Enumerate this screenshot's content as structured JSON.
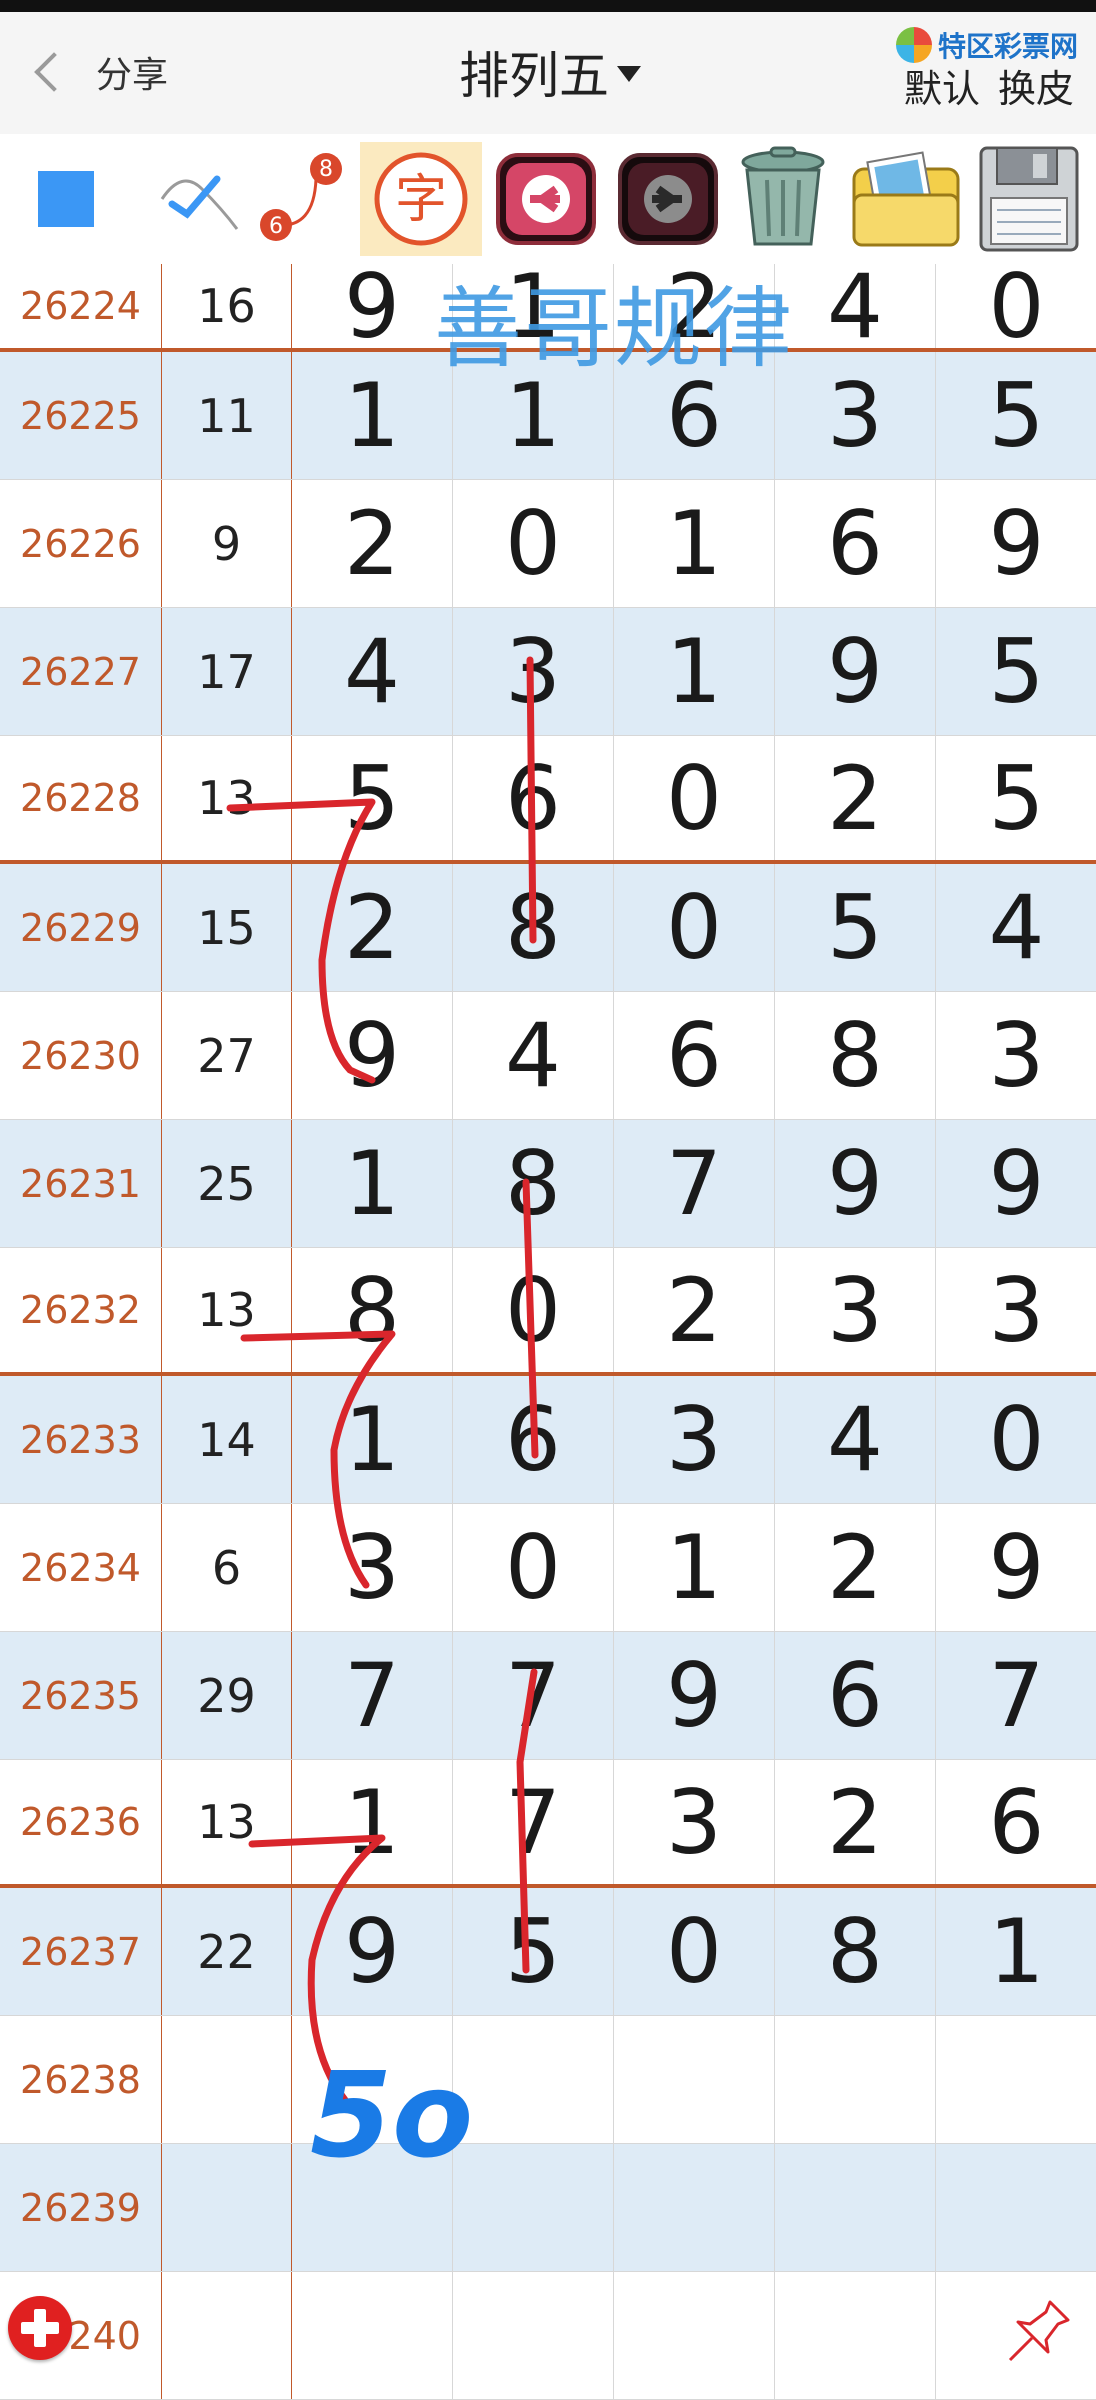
{
  "header": {
    "back_label": "分享",
    "title": "排列五",
    "logo_text": "特区彩票网",
    "right_actions": [
      "默认",
      "换皮"
    ]
  },
  "toolbar": {
    "tools": [
      "square-color-icon",
      "pen-icon",
      "6-8-link-icon",
      "text-tool-icon",
      "undo-arrow-icon",
      "redo-arrow-icon",
      "trash-icon",
      "photo-folder-icon",
      "save-disk-icon"
    ],
    "text_tool_glyph": "字",
    "link_tool_numbers": [
      "8",
      "6"
    ],
    "accent_blue": "#3b97f5",
    "accent_red": "#d9472b"
  },
  "rows": [
    {
      "issue": "26224",
      "sum": "16",
      "digits": [
        "9",
        "1",
        "2",
        "4",
        "0"
      ]
    },
    {
      "issue": "26225",
      "sum": "11",
      "digits": [
        "1",
        "1",
        "6",
        "3",
        "5"
      ]
    },
    {
      "issue": "26226",
      "sum": "9",
      "digits": [
        "2",
        "0",
        "1",
        "6",
        "9"
      ]
    },
    {
      "issue": "26227",
      "sum": "17",
      "digits": [
        "4",
        "3",
        "1",
        "9",
        "5"
      ]
    },
    {
      "issue": "26228",
      "sum": "13",
      "digits": [
        "5",
        "6",
        "0",
        "2",
        "5"
      ]
    },
    {
      "issue": "26229",
      "sum": "15",
      "digits": [
        "2",
        "8",
        "0",
        "5",
        "4"
      ]
    },
    {
      "issue": "26230",
      "sum": "27",
      "digits": [
        "9",
        "4",
        "6",
        "8",
        "3"
      ]
    },
    {
      "issue": "26231",
      "sum": "25",
      "digits": [
        "1",
        "8",
        "7",
        "9",
        "9"
      ]
    },
    {
      "issue": "26232",
      "sum": "13",
      "digits": [
        "8",
        "0",
        "2",
        "3",
        "3"
      ]
    },
    {
      "issue": "26233",
      "sum": "14",
      "digits": [
        "1",
        "6",
        "3",
        "4",
        "0"
      ]
    },
    {
      "issue": "26234",
      "sum": "6",
      "digits": [
        "3",
        "0",
        "1",
        "2",
        "9"
      ]
    },
    {
      "issue": "26235",
      "sum": "29",
      "digits": [
        "7",
        "7",
        "9",
        "6",
        "7"
      ]
    },
    {
      "issue": "26236",
      "sum": "13",
      "digits": [
        "1",
        "7",
        "3",
        "2",
        "6"
      ]
    },
    {
      "issue": "26237",
      "sum": "22",
      "digits": [
        "9",
        "5",
        "0",
        "8",
        "1"
      ]
    },
    {
      "issue": "26238",
      "sum": "",
      "digits": [
        "",
        "",
        "",
        "",
        ""
      ]
    },
    {
      "issue": "26239",
      "sum": "",
      "digits": [
        "",
        "",
        "",
        "",
        ""
      ]
    },
    {
      "issue": "26240",
      "sum": "",
      "digits": [
        "",
        "",
        "",
        "",
        ""
      ]
    }
  ],
  "separator_after_issues": [
    "26224",
    "26228",
    "26232",
    "26236"
  ],
  "annotations": {
    "watermark": "善哥规律",
    "handwritten_note": "5o",
    "stroke_color": "#d9262c",
    "note_color": "#1a7be6"
  },
  "footer": {
    "add_button": "plus-icon",
    "pin_button": "pin-icon"
  }
}
